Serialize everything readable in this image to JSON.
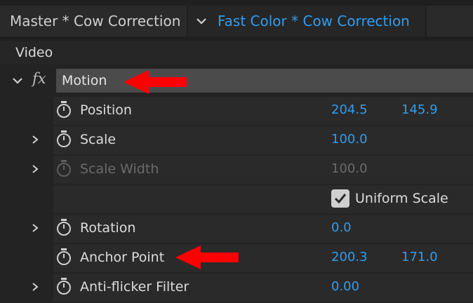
{
  "tabs": {
    "master_label": "Master * Cow Correction",
    "fast_color_label": "Fast Color * Cow Correction"
  },
  "section": {
    "title": "Video"
  },
  "effect": {
    "fx_label": "fx",
    "name": "Motion"
  },
  "properties": [
    {
      "label": "Position",
      "value1": "204.5",
      "value2": "145.9"
    },
    {
      "label": "Scale",
      "value1": "100.0"
    },
    {
      "label": "Scale Width",
      "value1": "100.0"
    },
    {
      "label": "Uniform Scale",
      "checked": true
    },
    {
      "label": "Rotation",
      "value1": "0.0"
    },
    {
      "label": "Anchor Point",
      "value1": "200.3",
      "value2": "171.0"
    },
    {
      "label": "Anti-flicker Filter",
      "value1": "0.00"
    }
  ],
  "colors": {
    "accent_blue": "#2f9df0",
    "annotation_red": "#ff0000",
    "panel_bg": "#232323",
    "motion_bar": "#4b4b4b"
  }
}
